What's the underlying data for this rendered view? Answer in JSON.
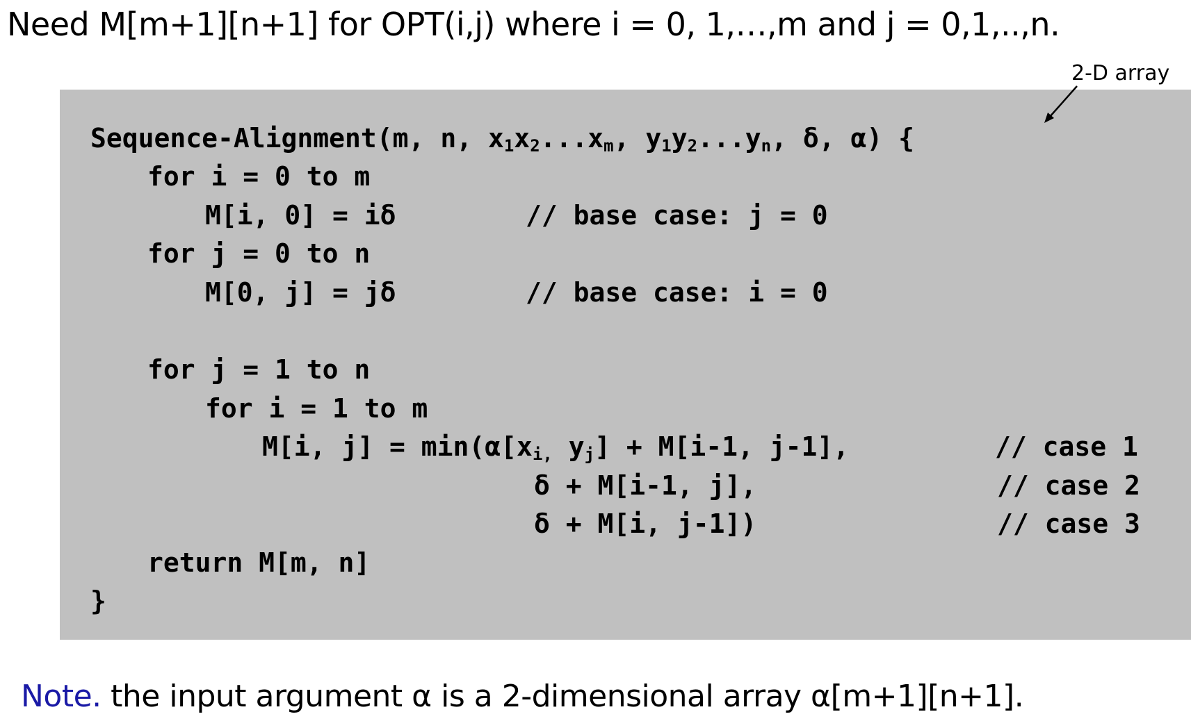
{
  "heading": "Need M[m+1][n+1] for OPT(i,j) where i = 0, 1,…,m and j = 0,1,..,n.",
  "annotation": "2-D array",
  "code": {
    "signature": {
      "prefix": "Sequence-Alignment(m, n, ",
      "x1": "x",
      "x1_sub": "1",
      "x2": "x",
      "x2_sub": "2",
      "xdots": "...",
      "xm": "x",
      "xm_sub": "m",
      "sep": ", ",
      "y1": "y",
      "y1_sub": "1",
      "y2": "y",
      "y2_sub": "2",
      "ydots": "...",
      "yn": "y",
      "yn_sub": "n",
      "suffix": ", δ, α) {"
    },
    "line2": "for i = 0 to m",
    "line3": "M[i, 0] = iδ",
    "line3_comment": "// base case: j = 0",
    "line4": "for j = 0 to n",
    "line5": "M[0, j] = jδ",
    "line5_comment": "// base case: i = 0",
    "line6": "for j = 1 to n",
    "line7": "for i = 1 to m",
    "line8": {
      "a": "M[i, j] = min(α[x",
      "a_sub": "i,",
      "b": " y",
      "b_sub": "j",
      "c": "] + M[i-1, j-1],",
      "comment": "// case 1"
    },
    "line9": "δ + M[i-1, j],",
    "line9_comment": "// case 2",
    "line10": "δ + M[i, j-1])",
    "line10_comment": "// case 3",
    "line11": "return M[m, n]",
    "line12": "}"
  },
  "note": {
    "label": "Note.",
    "text": " the input argument α is a 2-dimensional array α[m+1][n+1]."
  },
  "colors": {
    "code_background": "#c0c0c0",
    "note_label": "#1a1aa6"
  }
}
